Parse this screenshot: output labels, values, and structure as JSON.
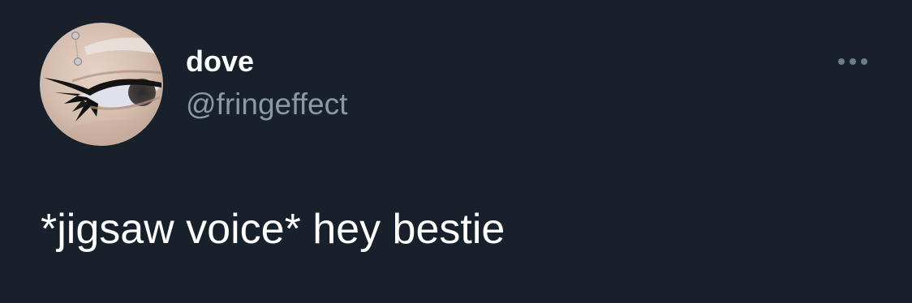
{
  "tweet": {
    "author": {
      "display_name": "dove",
      "handle": "@fringeffect",
      "avatar_icon": "avatar-eye-photo"
    },
    "more_icon": "more-options-icon",
    "text": "*jigsaw voice* hey bestie"
  },
  "colors": {
    "background": "#17202b",
    "primary_text": "#ffffff",
    "secondary_text": "#8b98a5",
    "icon": "#6e7c8a"
  }
}
